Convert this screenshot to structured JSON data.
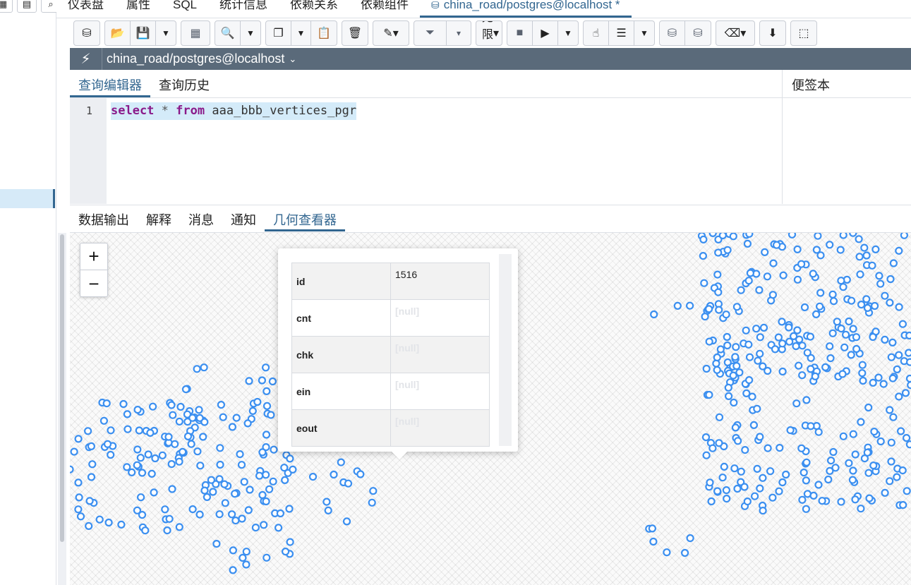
{
  "top_tabs": [
    {
      "label": "仪表盘"
    },
    {
      "label": "属性"
    },
    {
      "label": "SQL"
    },
    {
      "label": "统计信息"
    },
    {
      "label": "依赖关系"
    },
    {
      "label": "依赖组件"
    },
    {
      "label": "china_road/postgres@localhost *",
      "active": true
    }
  ],
  "toolbar": {
    "row_limit": "无限制"
  },
  "connection": {
    "label": "china_road/postgres@localhost"
  },
  "editor": {
    "tabs": [
      {
        "label": "查询编辑器",
        "active": true
      },
      {
        "label": "查询历史"
      }
    ],
    "scratch_pad_label": "便签本",
    "line_number": "1",
    "query": {
      "kw_select": "select",
      "star": "*",
      "kw_from": "from",
      "table": "aaa_bbb_vertices_pgr"
    }
  },
  "result_tabs": [
    {
      "label": "数据输出"
    },
    {
      "label": "解释"
    },
    {
      "label": "消息"
    },
    {
      "label": "通知"
    },
    {
      "label": "几何查看器",
      "active": true
    }
  ],
  "map": {
    "zoom_in": "+",
    "zoom_out": "−",
    "point_color": "#3b8ff0"
  },
  "popup": {
    "rows": [
      {
        "key": "id",
        "value": "1516"
      },
      {
        "key": "cnt",
        "value": "[null]"
      },
      {
        "key": "chk",
        "value": "[null]"
      },
      {
        "key": "ein",
        "value": "[null]"
      },
      {
        "key": "eout",
        "value": "[null]"
      }
    ]
  }
}
